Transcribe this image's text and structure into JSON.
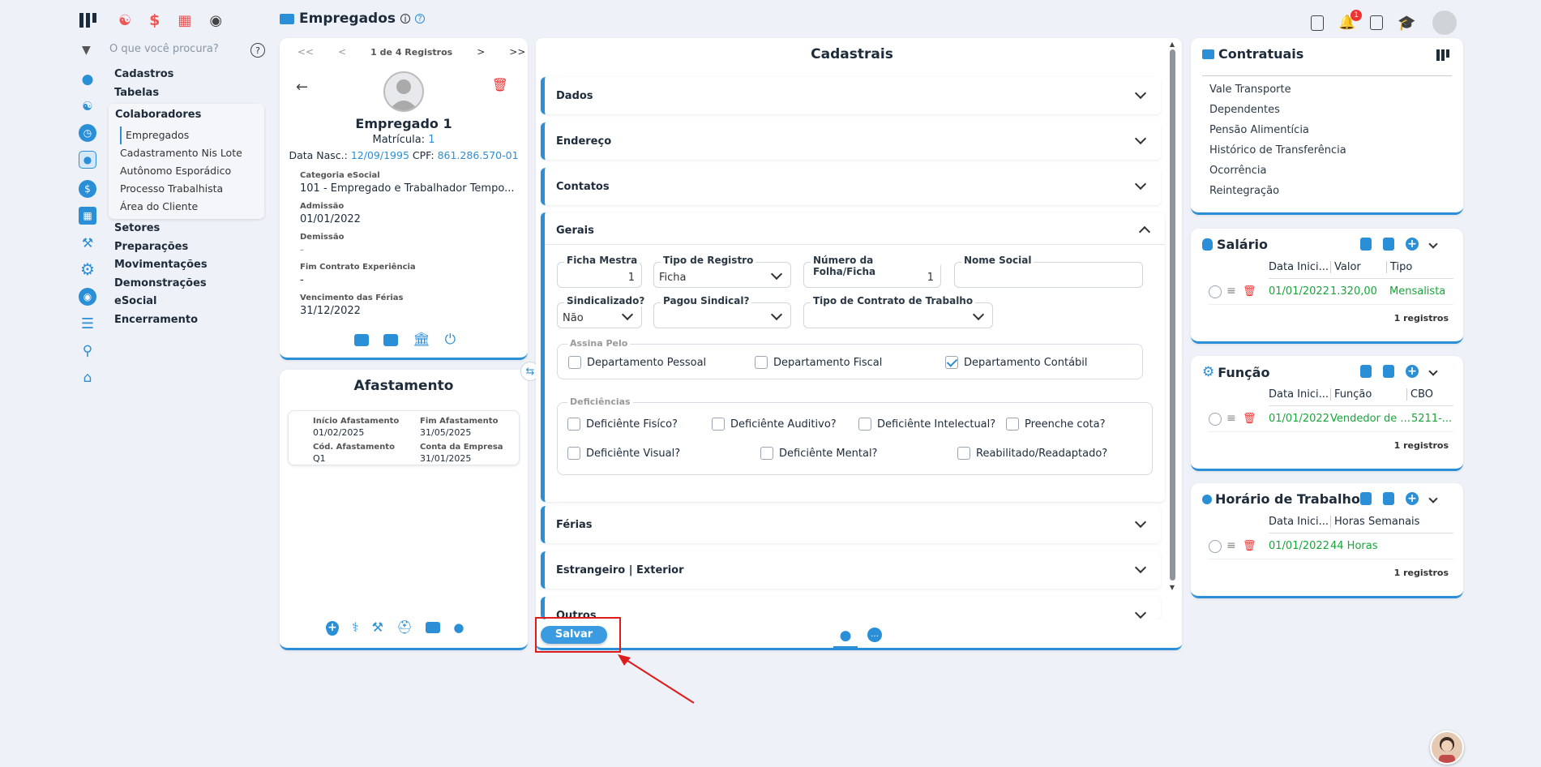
{
  "header": {
    "title": "Empregados",
    "notification_count": "1"
  },
  "topnav": {
    "icons": [
      "people-icon",
      "dollar-icon",
      "grid-icon",
      "money-bag-icon"
    ]
  },
  "sidebar": {
    "search_placeholder": "O que você procura?",
    "menu": {
      "cadastros": "Cadastros",
      "tabelas": "Tabelas",
      "colaboradores": "Colaboradores",
      "colaboradores_items": [
        "Empregados",
        "Cadastramento Nis Lote",
        "Autônomo Esporádico",
        "Processo Trabalhista",
        "Área do Cliente"
      ],
      "setores": "Setores",
      "preparacoes": "Preparações",
      "movimentacoes": "Movimentações",
      "demonstracoes": "Demonstrações",
      "esocial": "eSocial",
      "encerramento": "Encerramento"
    }
  },
  "employee": {
    "pager": "1 de 4 Registros",
    "pager_first": "<<",
    "pager_prev": "<",
    "pager_next": ">",
    "pager_last": ">>",
    "name": "Empregado 1",
    "matricula_label": "Matrícula:",
    "matricula": "1",
    "nasc_label": "Data Nasc.:",
    "nasc": "12/09/1995",
    "cpf_label": "CPF:",
    "cpf": "861.286.570-01",
    "fields": [
      {
        "label": "Categoria eSocial",
        "value": "101 - Empregado e Trabalhador Tempo..."
      },
      {
        "label": "Admissão",
        "value": "01/01/2022"
      },
      {
        "label": "Demissão",
        "value": "-"
      },
      {
        "label": "Fim Contrato Experiência",
        "value": "-"
      },
      {
        "label": "Vencimento das Férias",
        "value": "31/12/2022"
      }
    ]
  },
  "afastamento": {
    "title": "Afastamento",
    "inicio_label": "Início Afastamento",
    "inicio": "01/02/2025",
    "fim_label": "Fim Afastamento",
    "fim": "31/05/2025",
    "cod_label": "Cód. Afastamento",
    "cod": "Q1",
    "conta_label": "Conta da Empresa",
    "conta": "31/01/2025"
  },
  "cadastrais": {
    "title": "Cadastrais",
    "sections": {
      "dados": "Dados",
      "endereco": "Endereço",
      "contatos": "Contatos",
      "gerais": "Gerais",
      "ferias": "Férias",
      "estrangeiro": "Estrangeiro | Exterior",
      "outros": "Outros"
    },
    "gerais_fields": {
      "ficha_mestra_label": "Ficha Mestra",
      "ficha_mestra": "1",
      "tipo_registro_label": "Tipo de Registro",
      "tipo_registro": "Ficha",
      "numero_folha_label": "Número da Folha/Ficha",
      "numero_folha": "1",
      "nome_social_label": "Nome Social",
      "nome_social": "",
      "sindicalizado_label": "Sindicalizado?",
      "sindicalizado": "Não",
      "pagou_sindical_label": "Pagou Sindical?",
      "pagou_sindical": "",
      "tipo_contrato_label": "Tipo de Contrato de Trabalho",
      "tipo_contrato": ""
    },
    "assina_pelo": {
      "legend": "Assina Pelo",
      "options": [
        {
          "label": "Departamento Pessoal",
          "checked": false
        },
        {
          "label": "Departamento Fiscal",
          "checked": false
        },
        {
          "label": "Departamento Contábil",
          "checked": true
        }
      ]
    },
    "deficiencias": {
      "legend": "Deficiências",
      "options": [
        "Deficiênte Fisíco?",
        "Deficiênte Auditivo?",
        "Deficiênte Intelectual?",
        "Preenche cota?",
        "Deficiênte Visual?",
        "Deficiênte Mental?",
        "Reabilitado/Readaptado?"
      ]
    },
    "save_label": "Salvar"
  },
  "contratuais": {
    "title": "Contratuais",
    "links": [
      "Vale Transporte",
      "Dependentes",
      "Pensão Alimentícia",
      "Histórico de Transferência",
      "Ocorrência",
      "Reintegração"
    ]
  },
  "salario": {
    "title": "Salário",
    "cols": [
      "Data Inici...",
      "Valor",
      "Tipo"
    ],
    "row": [
      "01/01/2022",
      "1.320,00",
      "Mensalista"
    ],
    "count": "1 registros"
  },
  "funcao": {
    "title": "Função",
    "cols": [
      "Data Inici...",
      "Função",
      "CBO"
    ],
    "row": [
      "01/01/2022",
      "Vendedor de ...",
      "5211-..."
    ],
    "count": "1 registros"
  },
  "horario": {
    "title": "Horário de Trabalho",
    "cols": [
      "Data Inici...",
      "Horas Semanais"
    ],
    "row": [
      "01/01/2022",
      "44 Horas"
    ],
    "count": "1 registros"
  },
  "colors": {
    "accent": "#2a8fd6",
    "danger": "#e33333",
    "success": "#18a53a",
    "background": "#eef1f7"
  }
}
